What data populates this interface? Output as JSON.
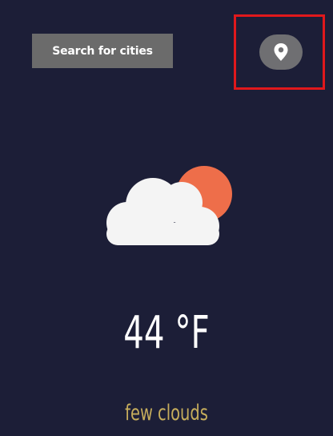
{
  "header": {
    "search_label": "Search for cities",
    "location_icon": "map-pin-icon"
  },
  "weather": {
    "icon": "few-clouds-icon",
    "temperature": "44 °F",
    "description": "few clouds"
  },
  "colors": {
    "background": "#1c1e37",
    "button_bg": "#6b6b6b",
    "sun": "#ee6e4a",
    "cloud": "#f4f4f4",
    "description": "#c6ad5c",
    "highlight": "#e0181c"
  }
}
